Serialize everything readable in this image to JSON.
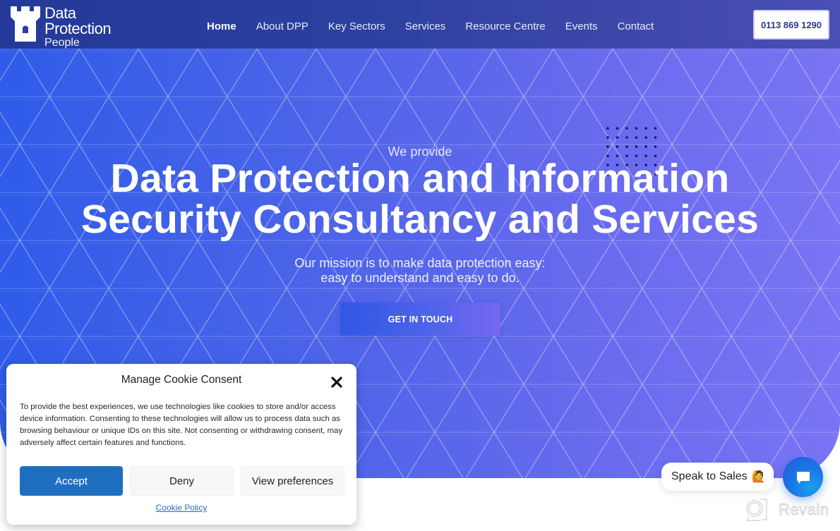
{
  "header": {
    "logo": {
      "line1": "Data",
      "line2": "Protection",
      "line3": "People",
      "icon": "castle-tower-icon"
    },
    "nav": [
      {
        "label": "Home",
        "active": true
      },
      {
        "label": "About DPP",
        "active": false
      },
      {
        "label": "Key Sectors",
        "active": false
      },
      {
        "label": "Services",
        "active": false
      },
      {
        "label": "Resource Centre",
        "active": false
      },
      {
        "label": "Events",
        "active": false
      },
      {
        "label": "Contact",
        "active": false
      }
    ],
    "phone_button": "0113 869 1290"
  },
  "hero": {
    "eyebrow": "We provide",
    "headline_line1": "Data Protection and Information",
    "headline_line2": "Security Consultancy and Services",
    "mission_line1": "Our mission is to make data protection easy:",
    "mission_line2": "easy to understand and easy to do.",
    "cta_label": "GET IN TOUCH"
  },
  "cookie_modal": {
    "title": "Manage Cookie Consent",
    "close_icon": "close-icon",
    "body": "To provide the best experiences, we use technologies like cookies to store and/or access device information. Consenting to these technologies will allow us to process data such as browsing behaviour or unique IDs on this site. Not consenting or withdrawing consent, may adversely affect certain features and functions.",
    "buttons": {
      "accept": "Accept",
      "deny": "Deny",
      "preferences": "View preferences"
    },
    "policy_link": "Cookie Policy"
  },
  "chat": {
    "speak_label": "Speak to Sales",
    "speak_emoji": "🙋",
    "chat_icon": "chat-bubble-icon"
  },
  "watermark": {
    "text": "Revain"
  },
  "colors": {
    "header_bg": "#2b3f9e",
    "hero_start": "#2f5ce9",
    "hero_end": "#7b74f4",
    "accept_blue": "#1f6fc0",
    "phone_text": "#2a3a8e",
    "chat_blue": "#1a78e6"
  }
}
